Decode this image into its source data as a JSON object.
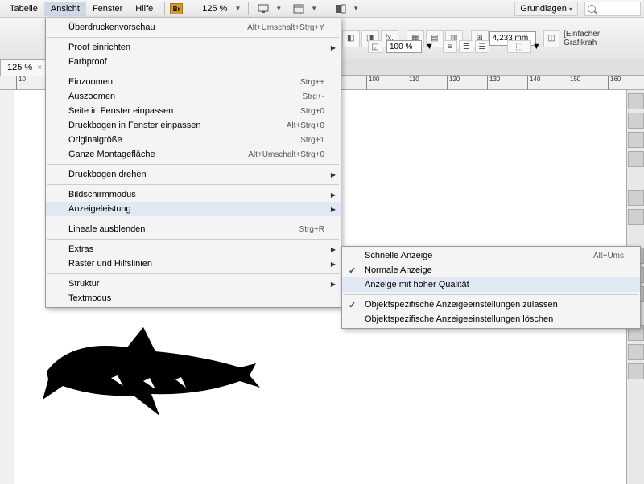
{
  "menubar": {
    "items": [
      "Tabelle",
      "Ansicht",
      "Fenster",
      "Hilfe"
    ],
    "br": "Br",
    "zoom": "125 %",
    "workspace": "Grundlagen"
  },
  "toolbar": {
    "measurement": "4,233 mm",
    "right_label": "[Einfacher Grafikrah",
    "zoom100": "100 %"
  },
  "tab": {
    "label": "125 %",
    "ruler0": "10"
  },
  "ruler_ticks": [
    "100",
    "110",
    "120",
    "130",
    "140",
    "150",
    "160"
  ],
  "menu1": [
    {
      "label": "Überdruckenvorschau",
      "sc": "Alt+Umschalt+Strg+Y"
    },
    {
      "sep": true
    },
    {
      "label": "Proof einrichten",
      "sub": true
    },
    {
      "label": "Farbproof"
    },
    {
      "sep": true
    },
    {
      "label": "Einzoomen",
      "sc": "Strg++"
    },
    {
      "label": "Auszoomen",
      "sc": "Strg+-"
    },
    {
      "label": "Seite in Fenster einpassen",
      "sc": "Strg+0"
    },
    {
      "label": "Druckbogen in Fenster einpassen",
      "sc": "Alt+Strg+0"
    },
    {
      "label": "Originalgröße",
      "sc": "Strg+1"
    },
    {
      "label": "Ganze Montagefläche",
      "sc": "Alt+Umschalt+Strg+0"
    },
    {
      "sep": true
    },
    {
      "label": "Druckbogen drehen",
      "sub": true
    },
    {
      "sep": true
    },
    {
      "label": "Bildschirmmodus",
      "sub": true
    },
    {
      "label": "Anzeigeleistung",
      "sub": true,
      "hovered": true
    },
    {
      "sep": true
    },
    {
      "label": "Lineale ausblenden",
      "sc": "Strg+R"
    },
    {
      "sep": true
    },
    {
      "label": "Extras",
      "sub": true
    },
    {
      "label": "Raster und Hilfslinien",
      "sub": true
    },
    {
      "sep": true
    },
    {
      "label": "Struktur",
      "sub": true
    },
    {
      "label": "Textmodus"
    }
  ],
  "menu2": [
    {
      "label": "Schnelle Anzeige",
      "sc": "Alt+Ums"
    },
    {
      "label": "Normale Anzeige",
      "checked": true
    },
    {
      "label": "Anzeige mit hoher Qualität",
      "hovered": true
    },
    {
      "sep": true
    },
    {
      "label": "Objektspezifische Anzeigeeinstellungen zulassen",
      "checked": true
    },
    {
      "label": "Objektspezifische Anzeigeeinstellungen löschen"
    }
  ]
}
